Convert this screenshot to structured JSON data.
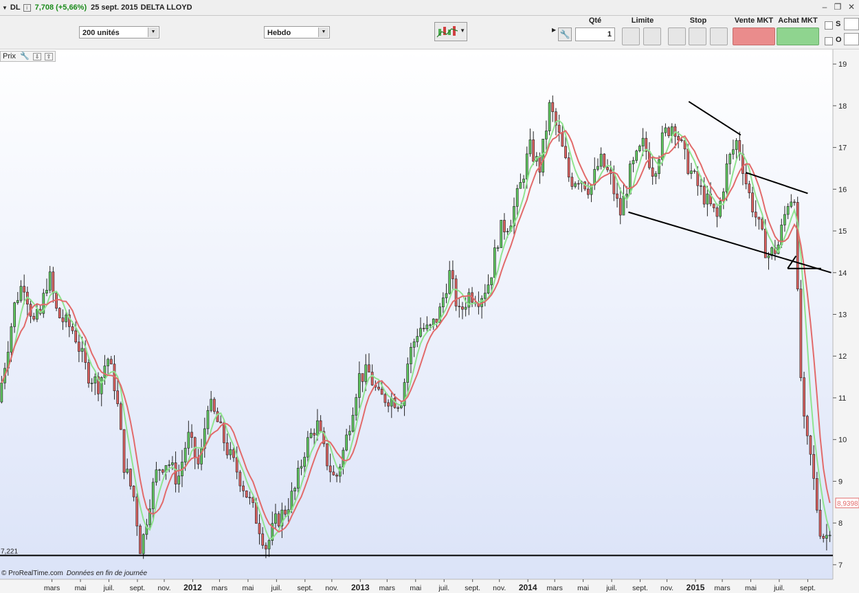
{
  "header": {
    "symbol": "DL",
    "price_change": "7,708 (+5,66%)",
    "date": "25 sept. 2015",
    "name": "DELTA LLOYD"
  },
  "toolbar": {
    "quantity_select": "200 unités",
    "period_select": "Hebdo"
  },
  "order_panel": {
    "qty_label": "Qté",
    "qty_value": "1",
    "limit_label": "Limite",
    "stop_label": "Stop",
    "sell_label": "Vente MKT",
    "buy_label": "Achat MKT",
    "s_label": "S",
    "o_label": "O"
  },
  "chart_panel": {
    "label": "Prix"
  },
  "footer": {
    "copyright": "© ProRealTime.com",
    "note": "Données en fin de journée"
  },
  "chart_data": {
    "type": "candlestick",
    "ylim": [
      6.8,
      19.25
    ],
    "y_ticks": [
      7,
      8,
      9,
      10,
      11,
      12,
      13,
      14,
      15,
      16,
      17,
      18,
      19
    ],
    "x_range": [
      2010.85,
      2015.82
    ],
    "x_ticks": [
      {
        "label": "mars",
        "x": 2011.16,
        "bold": false
      },
      {
        "label": "mai",
        "x": 2011.33,
        "bold": false
      },
      {
        "label": "juil.",
        "x": 2011.5,
        "bold": false
      },
      {
        "label": "sept.",
        "x": 2011.67,
        "bold": false
      },
      {
        "label": "nov.",
        "x": 2011.83,
        "bold": false
      },
      {
        "label": "2012",
        "x": 2012.0,
        "bold": true
      },
      {
        "label": "mars",
        "x": 2012.16,
        "bold": false
      },
      {
        "label": "mai",
        "x": 2012.33,
        "bold": false
      },
      {
        "label": "juil.",
        "x": 2012.5,
        "bold": false
      },
      {
        "label": "sept.",
        "x": 2012.67,
        "bold": false
      },
      {
        "label": "nov.",
        "x": 2012.83,
        "bold": false
      },
      {
        "label": "2013",
        "x": 2013.0,
        "bold": true
      },
      {
        "label": "mars",
        "x": 2013.16,
        "bold": false
      },
      {
        "label": "mai",
        "x": 2013.33,
        "bold": false
      },
      {
        "label": "juil.",
        "x": 2013.5,
        "bold": false
      },
      {
        "label": "sept.",
        "x": 2013.67,
        "bold": false
      },
      {
        "label": "nov.",
        "x": 2013.83,
        "bold": false
      },
      {
        "label": "2014",
        "x": 2014.0,
        "bold": true
      },
      {
        "label": "mars",
        "x": 2014.16,
        "bold": false
      },
      {
        "label": "mai",
        "x": 2014.33,
        "bold": false
      },
      {
        "label": "juil.",
        "x": 2014.5,
        "bold": false
      },
      {
        "label": "sept.",
        "x": 2014.67,
        "bold": false
      },
      {
        "label": "nov.",
        "x": 2014.83,
        "bold": false
      },
      {
        "label": "2015",
        "x": 2015.0,
        "bold": true
      },
      {
        "label": "mars",
        "x": 2015.16,
        "bold": false
      },
      {
        "label": "mai",
        "x": 2015.33,
        "bold": false
      },
      {
        "label": "juil.",
        "x": 2015.5,
        "bold": false
      },
      {
        "label": "sept.",
        "x": 2015.67,
        "bold": false
      }
    ],
    "key_points": [
      [
        2010.85,
        10.9
      ],
      [
        2010.95,
        13.3
      ],
      [
        2011.0,
        13.8
      ],
      [
        2011.06,
        12.8
      ],
      [
        2011.1,
        13.0
      ],
      [
        2011.15,
        14.0
      ],
      [
        2011.2,
        13.0
      ],
      [
        2011.3,
        12.6
      ],
      [
        2011.38,
        11.6
      ],
      [
        2011.45,
        11.3
      ],
      [
        2011.5,
        12.0
      ],
      [
        2011.55,
        11.2
      ],
      [
        2011.6,
        9.4
      ],
      [
        2011.66,
        8.6
      ],
      [
        2011.7,
        7.3
      ],
      [
        2011.75,
        8.5
      ],
      [
        2011.8,
        9.3
      ],
      [
        2011.86,
        9.5
      ],
      [
        2011.92,
        9.0
      ],
      [
        2011.98,
        10.1
      ],
      [
        2012.05,
        9.3
      ],
      [
        2012.1,
        10.9
      ],
      [
        2012.15,
        10.5
      ],
      [
        2012.22,
        9.7
      ],
      [
        2012.28,
        9.2
      ],
      [
        2012.34,
        8.6
      ],
      [
        2012.4,
        8.0
      ],
      [
        2012.45,
        7.4
      ],
      [
        2012.5,
        8.0
      ],
      [
        2012.56,
        8.3
      ],
      [
        2012.62,
        8.8
      ],
      [
        2012.68,
        9.8
      ],
      [
        2012.75,
        10.4
      ],
      [
        2012.8,
        9.6
      ],
      [
        2012.86,
        9.0
      ],
      [
        2012.92,
        9.9
      ],
      [
        2013.0,
        11.5
      ],
      [
        2013.06,
        11.6
      ],
      [
        2013.12,
        11.0
      ],
      [
        2013.18,
        11.0
      ],
      [
        2013.25,
        10.9
      ],
      [
        2013.3,
        12.0
      ],
      [
        2013.36,
        12.7
      ],
      [
        2013.42,
        12.6
      ],
      [
        2013.48,
        13.0
      ],
      [
        2013.54,
        14.0
      ],
      [
        2013.6,
        13.0
      ],
      [
        2013.66,
        13.5
      ],
      [
        2013.72,
        13.4
      ],
      [
        2013.78,
        13.8
      ],
      [
        2013.84,
        15.0
      ],
      [
        2013.9,
        15.2
      ],
      [
        2013.96,
        16.0
      ],
      [
        2014.02,
        17.0
      ],
      [
        2014.08,
        16.5
      ],
      [
        2014.14,
        18.0
      ],
      [
        2014.2,
        17.2
      ],
      [
        2014.26,
        16.2
      ],
      [
        2014.32,
        16.3
      ],
      [
        2014.38,
        16.0
      ],
      [
        2014.44,
        16.7
      ],
      [
        2014.5,
        16.3
      ],
      [
        2014.56,
        15.4
      ],
      [
        2014.62,
        16.4
      ],
      [
        2014.7,
        17.1
      ],
      [
        2014.76,
        16.4
      ],
      [
        2014.82,
        17.3
      ],
      [
        2014.88,
        17.6
      ],
      [
        2014.95,
        16.7
      ],
      [
        2015.02,
        16.1
      ],
      [
        2015.08,
        15.7
      ],
      [
        2015.14,
        15.3
      ],
      [
        2015.2,
        16.6
      ],
      [
        2015.26,
        17.2
      ],
      [
        2015.32,
        16.0
      ],
      [
        2015.38,
        15.2
      ],
      [
        2015.44,
        14.4
      ],
      [
        2015.5,
        14.6
      ],
      [
        2015.56,
        15.7
      ],
      [
        2015.6,
        15.9
      ],
      [
        2015.63,
        12.0
      ],
      [
        2015.66,
        10.2
      ],
      [
        2015.7,
        9.5
      ],
      [
        2015.73,
        8.5
      ],
      [
        2015.76,
        7.7
      ]
    ],
    "last_close": 7.708,
    "ma_short_color": "#8fe48f",
    "ma_long_color": "#e26a6a",
    "bull_color": "#5fc55f",
    "bear_color": "#d9605f",
    "ma_last_label": "8,9398",
    "support_line": {
      "y": 7.221,
      "label": "7,221"
    },
    "trendlines": [
      {
        "from": [
          2014.96,
          18.1
        ],
        "to": [
          2015.27,
          17.3
        ]
      },
      {
        "from": [
          2015.3,
          16.4
        ],
        "to": [
          2015.67,
          15.9
        ]
      },
      {
        "from": [
          2014.6,
          15.45
        ],
        "to": [
          2015.81,
          14.0
        ]
      },
      {
        "from": [
          2015.55,
          14.1
        ],
        "to": [
          2015.75,
          14.1
        ]
      },
      {
        "from": [
          2015.55,
          14.1
        ],
        "to": [
          2015.6,
          14.4
        ]
      }
    ]
  }
}
